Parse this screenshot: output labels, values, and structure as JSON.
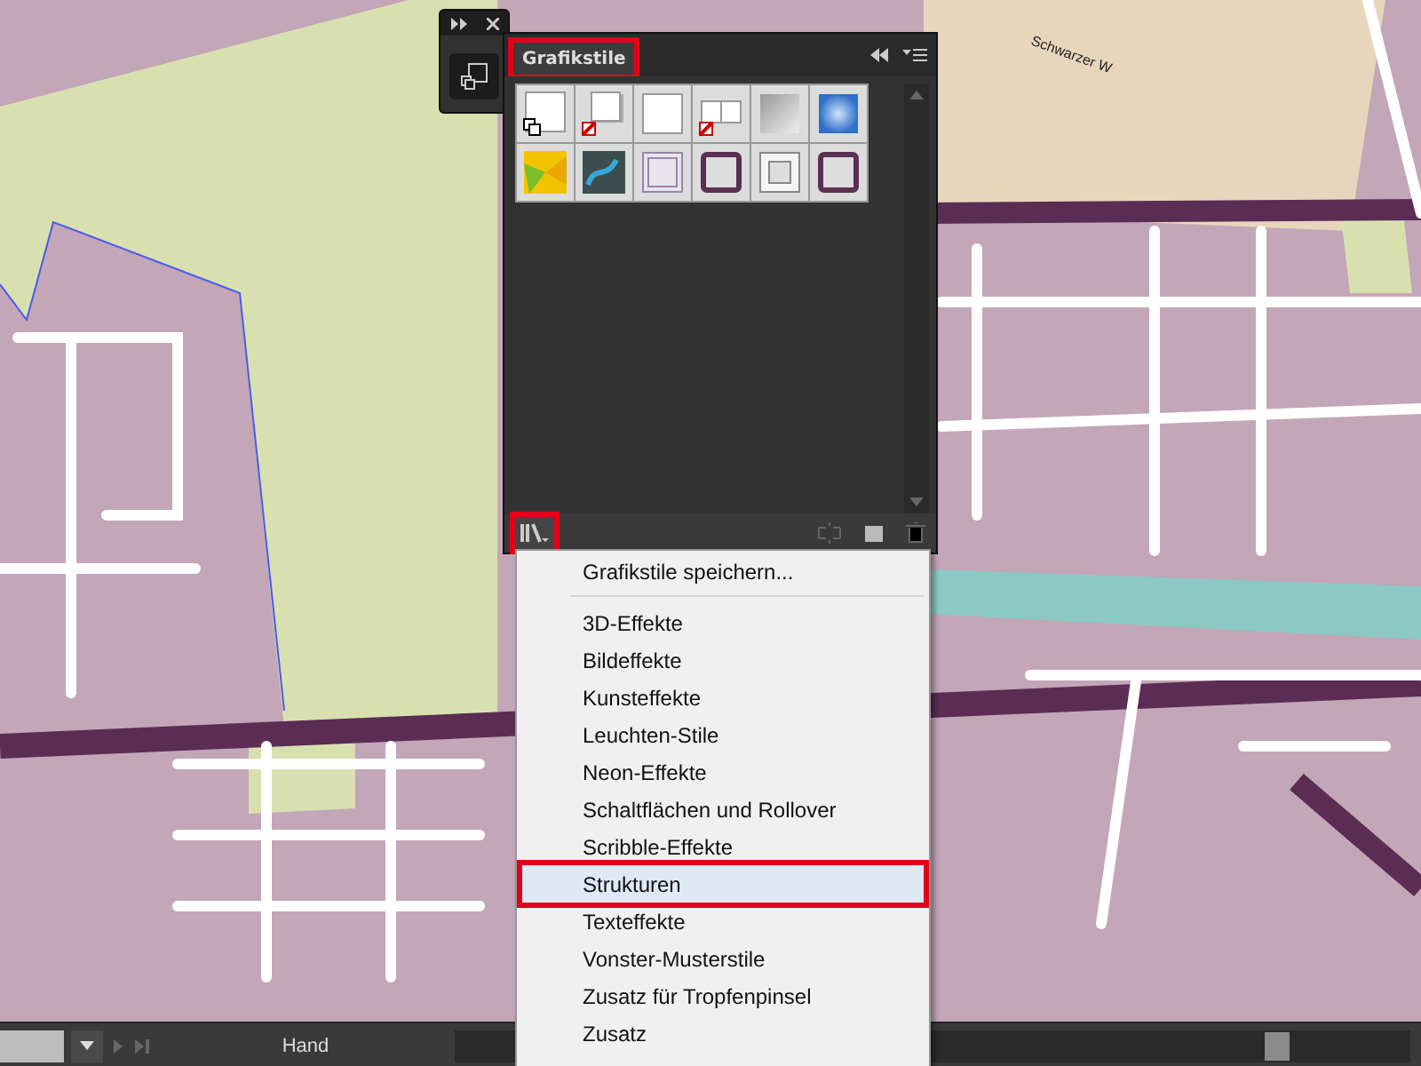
{
  "map": {
    "street_label": "Schwarzer W"
  },
  "panel": {
    "title": "Grafikstile",
    "tab_highlighted": true,
    "library_button_highlighted": true,
    "swatches": [
      {
        "kind": "default"
      },
      {
        "kind": "none-shadow"
      },
      {
        "kind": "plain"
      },
      {
        "kind": "none-split"
      },
      {
        "kind": "gradient-grey"
      },
      {
        "kind": "gradient-blue"
      },
      {
        "kind": "yellow-texture"
      },
      {
        "kind": "blue-texture"
      },
      {
        "kind": "thin-frame"
      },
      {
        "kind": "thick-frame"
      },
      {
        "kind": "double-frame"
      },
      {
        "kind": "thick-frame"
      }
    ]
  },
  "menu": {
    "items": [
      {
        "kind": "item",
        "label": "Grafikstile speichern...",
        "selected": false
      },
      {
        "kind": "separator"
      },
      {
        "kind": "item",
        "label": "3D-Effekte",
        "selected": false
      },
      {
        "kind": "item",
        "label": "Bildeffekte",
        "selected": false
      },
      {
        "kind": "item",
        "label": "Kunsteffekte",
        "selected": false
      },
      {
        "kind": "item",
        "label": "Leuchten-Stile",
        "selected": false
      },
      {
        "kind": "item",
        "label": "Neon-Effekte",
        "selected": false
      },
      {
        "kind": "item",
        "label": "Schaltflächen und Rollover",
        "selected": false
      },
      {
        "kind": "item",
        "label": "Scribble-Effekte",
        "selected": false
      },
      {
        "kind": "item",
        "label": "Strukturen",
        "selected": true
      },
      {
        "kind": "item",
        "label": "Texteffekte",
        "selected": false
      },
      {
        "kind": "item",
        "label": "Vonster-Musterstile",
        "selected": false
      },
      {
        "kind": "item",
        "label": "Zusatz für Tropfenpinsel",
        "selected": false
      },
      {
        "kind": "item",
        "label": "Zusatz",
        "selected": false
      }
    ]
  },
  "status_bar": {
    "tool": "Hand"
  }
}
